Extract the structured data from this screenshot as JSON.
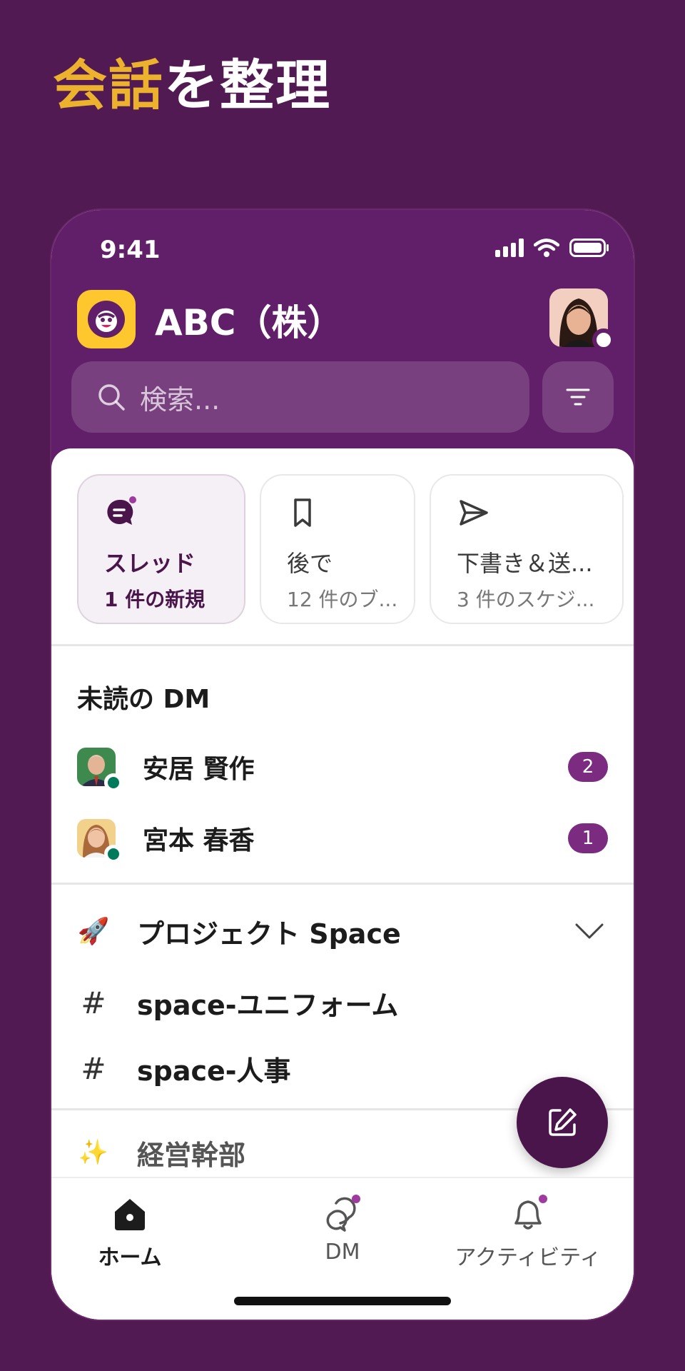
{
  "headline": {
    "highlight": "会話",
    "rest": "を整理"
  },
  "status_bar": {
    "time": "9:41"
  },
  "workspace": {
    "name": "ABC（株）"
  },
  "search": {
    "placeholder": "検索..."
  },
  "cards": [
    {
      "title": "スレッド",
      "sub": "1 件の新規",
      "icon": "threads-icon"
    },
    {
      "title": "後で",
      "sub": "12 件のブ...",
      "icon": "bookmark-icon"
    },
    {
      "title": "下書き＆送...",
      "sub": "3 件のスケジ...",
      "icon": "send-icon"
    }
  ],
  "unread_dm": {
    "title": "未読の DM",
    "items": [
      {
        "name": "安居 賢作",
        "count": "2"
      },
      {
        "name": "宮本 春香",
        "count": "1"
      }
    ]
  },
  "section": {
    "icon": "🚀",
    "title": "プロジェクト Space",
    "channels": [
      {
        "name": "space-ユニフォーム"
      },
      {
        "name": "space-人事"
      }
    ]
  },
  "section2": {
    "icon": "✨",
    "title": "経営幹部"
  },
  "tabs": [
    {
      "label": "ホーム"
    },
    {
      "label": "DM"
    },
    {
      "label": "アクティビティ"
    }
  ],
  "colors": {
    "brand_purple": "#611f69",
    "accent_yellow": "#ecb22e",
    "online_green": "#007a5a"
  }
}
